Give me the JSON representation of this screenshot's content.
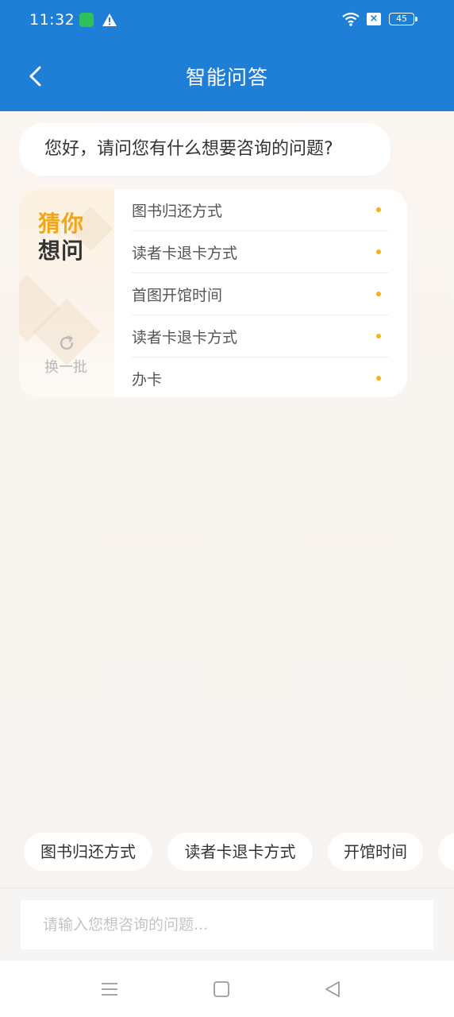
{
  "status_bar": {
    "time": "11:32",
    "battery": "45"
  },
  "header": {
    "title": "智能问答",
    "back_icon": "chevron-left-icon"
  },
  "chat": {
    "greeting": "您好，请问您有什么想要咨询的问题?"
  },
  "guess_card": {
    "title_line1": "猜你",
    "title_line2": "想问",
    "refresh_label": "换一批",
    "items": [
      {
        "label": "图书归还方式"
      },
      {
        "label": "读者卡退卡方式"
      },
      {
        "label": "首图开馆时间"
      },
      {
        "label": "读者卡退卡方式"
      },
      {
        "label": "办卡"
      }
    ]
  },
  "quick_chips": [
    {
      "label": "图书归还方式"
    },
    {
      "label": "读者卡退卡方式"
    },
    {
      "label": "开馆时间"
    }
  ],
  "input": {
    "placeholder": "请输入您想咨询的问题..."
  },
  "colors": {
    "brand_blue": "#1f7fd6",
    "accent_orange": "#f2a614",
    "dot_yellow": "#f5b21a"
  },
  "system_nav": {
    "menu_icon": "menu-icon",
    "home_icon": "home-square-icon",
    "back_icon": "back-triangle-icon"
  }
}
